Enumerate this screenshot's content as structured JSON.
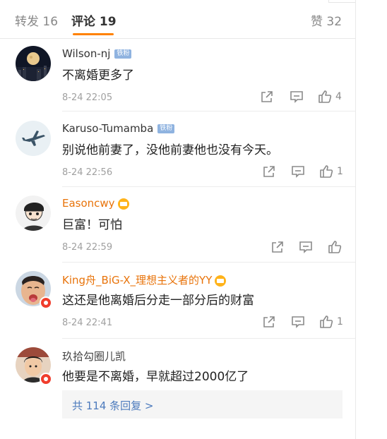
{
  "tabs": {
    "reposts": "转发 16",
    "comments": "评论 19",
    "likes": "赞 32"
  },
  "comments": [
    {
      "user": "Wilson-nj",
      "tag": "铁粉",
      "text": "不离婚更多了",
      "time": "8-24 22:05",
      "likes": "4"
    },
    {
      "user": "Karuso-Tumamba",
      "tag": "铁粉",
      "text": "别说他前妻了，没他前妻他也没有今天。",
      "time": "8-24 22:56",
      "likes": "1"
    },
    {
      "user": "Easoncwy",
      "text": "巨富！可怕",
      "time": "8-24 22:59",
      "likes": ""
    },
    {
      "user": "King舟_BiG-X_理想主义者的YY",
      "text": "这还是他离婚后分走一部分后的财富",
      "time": "8-24 22:41",
      "likes": "1"
    },
    {
      "user": "玖拾勾圈儿凯",
      "text": "他要是不离婚，早就超过2000亿了",
      "reply_summary": "共 114 条回复 >"
    }
  ],
  "colors": {
    "accent": "#ff8200",
    "vip_name": "#e8730a",
    "reply_link": "#4d7bbd"
  },
  "icons": [
    "share-icon",
    "comment-icon",
    "like-icon",
    "crown-icon",
    "vip-badge-icon"
  ]
}
